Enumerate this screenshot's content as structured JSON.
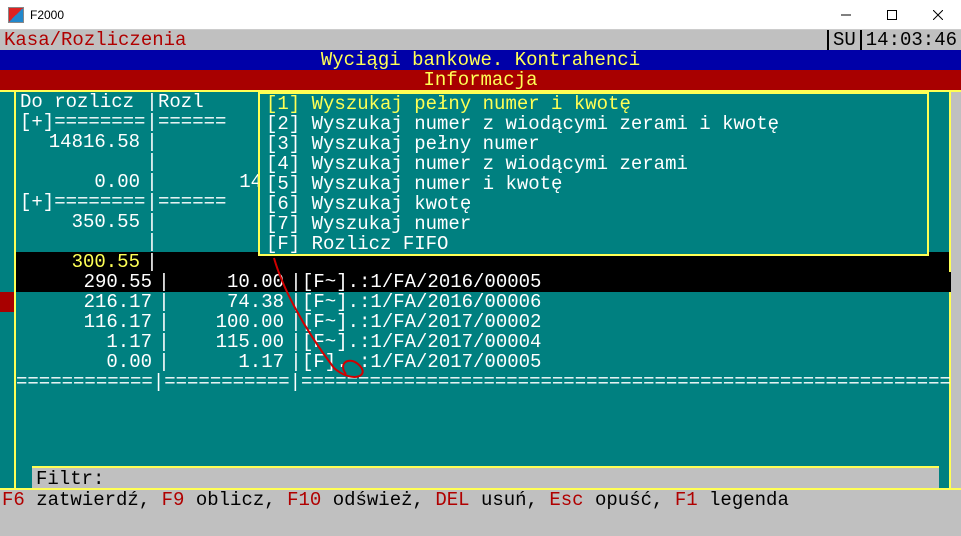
{
  "window": {
    "title": "F2000"
  },
  "status": {
    "module": "Kasa/Rozliczenia",
    "mode": "SU",
    "clock": "14:03:46"
  },
  "headers": {
    "main": "Wyciągi bankowe. Kontrahenci",
    "sub": "Informacja"
  },
  "columns": {
    "c1": "Do rozlicz",
    "c2": "Rozl"
  },
  "upper_rows": [
    {
      "c1": "[+]========",
      "c2": "======",
      "eq": true
    },
    {
      "c1": "14816.58",
      "c2": ""
    },
    {
      "c1": "",
      "c2": ""
    },
    {
      "c1": "0.00",
      "c2": "14"
    },
    {
      "c1": "[+]========",
      "c2": "======",
      "eq": true
    },
    {
      "c1": "350.55",
      "c2": ""
    },
    {
      "c1": "",
      "c2": ""
    },
    {
      "c1": "300.55",
      "c2": "",
      "hl": true
    }
  ],
  "popup": {
    "options": [
      {
        "key": "[1]",
        "label": "Wyszukaj pełny numer i kwotę",
        "selected": true
      },
      {
        "key": "[2]",
        "label": "Wyszukaj numer z wiodącymi zerami i kwotę"
      },
      {
        "key": "[3]",
        "label": "Wyszukaj pełny numer"
      },
      {
        "key": "[4]",
        "label": "Wyszukaj numer z wiodącymi zerami"
      },
      {
        "key": "[5]",
        "label": "Wyszukaj numer i kwotę"
      },
      {
        "key": "[6]",
        "label": "Wyszukaj kwotę"
      },
      {
        "key": "[7]",
        "label": "Wyszukaj numer"
      },
      {
        "key": "[F]",
        "label": "Rozlicz FIFO"
      }
    ]
  },
  "detail": [
    {
      "c1": "290.55",
      "c2": "10.00",
      "doc": "[F~].:1/FA/2016/00005",
      "black": true
    },
    {
      "c1": "216.17",
      "c2": "74.38",
      "doc": "[F~].:1/FA/2016/00006"
    },
    {
      "c1": "116.17",
      "c2": "100.00",
      "doc": "[F~].:1/FA/2017/00002"
    },
    {
      "c1": "1.17",
      "c2": "115.00",
      "doc": "[F~].:1/FA/2017/00004"
    },
    {
      "c1": "0.00",
      "c2": "1.17",
      "doc": "[F]. :1/FA/2017/00005"
    }
  ],
  "eqline": "============|===========|===============================================================",
  "filter": {
    "label": "Filtr:"
  },
  "footer": {
    "parts": [
      {
        "k": "F6",
        "t": " zatwierdź, "
      },
      {
        "k": "F9",
        "t": " oblicz, "
      },
      {
        "k": "F10",
        "t": " odśwież, "
      },
      {
        "k": "DEL",
        "t": " usuń, "
      },
      {
        "k": "Esc",
        "t": " opuść, "
      },
      {
        "k": "F1",
        "t": " legenda"
      }
    ]
  }
}
